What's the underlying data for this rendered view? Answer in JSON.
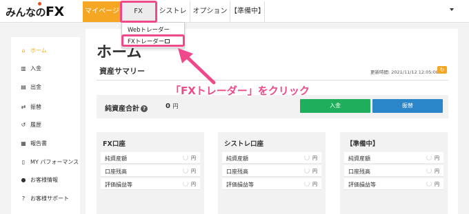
{
  "header": {
    "logo_text": "みんなの",
    "logo_fx": "FX",
    "tabs": [
      {
        "label": "マイページ"
      },
      {
        "label": "FX"
      },
      {
        "label": "シストレ"
      },
      {
        "label": "オプション"
      },
      {
        "label": "【準備中】"
      }
    ]
  },
  "dropdown": {
    "items": [
      {
        "label": "Webトレーダー"
      },
      {
        "label": "FXトレーダー"
      }
    ]
  },
  "sidebar": {
    "items": [
      {
        "label": "ホーム",
        "icon": "home-icon",
        "glyph": "⌂"
      },
      {
        "label": "入金",
        "icon": "bank-icon",
        "glyph": "▥"
      },
      {
        "label": "出金",
        "icon": "withdraw-icon",
        "glyph": "▤"
      },
      {
        "label": "振替",
        "icon": "transfer-icon",
        "glyph": "⇄"
      },
      {
        "label": "履歴",
        "icon": "history-icon",
        "glyph": "↺"
      },
      {
        "label": "報告書",
        "icon": "report-icon",
        "glyph": "▦"
      },
      {
        "label": "MY パフォーマンス",
        "icon": "performance-icon",
        "glyph": "▯"
      },
      {
        "label": "お客様情報",
        "icon": "user-icon",
        "glyph": "●"
      },
      {
        "label": "お客様サポート",
        "icon": "help-icon",
        "glyph": "?"
      }
    ]
  },
  "main": {
    "title": "ホーム",
    "summary_title": "資産サマリー",
    "updated": "更新時間: 2021/11/12 12:05:08",
    "refresh_glyph": "↻",
    "total_label": "純資産合計",
    "total_help": "?",
    "total_value": "0",
    "total_unit": "円",
    "deposit_label": "入金",
    "transfer_label": "振替"
  },
  "panels": [
    {
      "title": "FX口座",
      "rows": [
        {
          "label": "純資産額",
          "value": "円"
        },
        {
          "label": "口座残高",
          "value": "円"
        },
        {
          "label": "評価損益等",
          "value": "円"
        }
      ]
    },
    {
      "title": "シストレ口座",
      "rows": [
        {
          "label": "純資産額",
          "value": "円"
        },
        {
          "label": "口座残高",
          "value": "円"
        },
        {
          "label": "評価損益等",
          "value": "円"
        }
      ]
    },
    {
      "title": "【準備中】",
      "rows": [
        {
          "label": "純資産額",
          "value": "円"
        },
        {
          "label": "口座残高",
          "value": "円"
        },
        {
          "label": "評価損益等",
          "value": "円"
        }
      ]
    }
  ],
  "annotation": {
    "text": "「FXトレーダー」をクリック",
    "color": "#f0498b"
  },
  "colors": {
    "accent": "#f5a623",
    "deposit": "#1fae5b",
    "transfer": "#2a86c8"
  }
}
